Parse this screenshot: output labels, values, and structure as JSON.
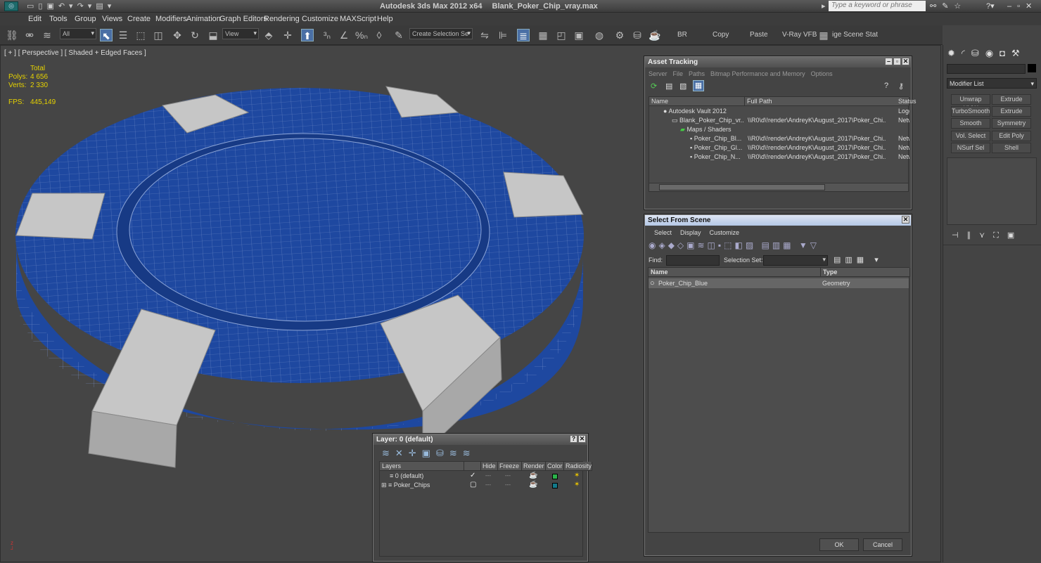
{
  "app": {
    "title": "Autodesk 3ds Max  2012 x64",
    "file": "Blank_Poker_Chip_vray.max",
    "search_placeholder": "Type a keyword or phrase"
  },
  "menu": [
    "Edit",
    "Tools",
    "Group",
    "Views",
    "Create",
    "Modifiers",
    "Animation",
    "Graph Editors",
    "Rendering",
    "Customize",
    "MAXScript",
    "Help"
  ],
  "toolbar": {
    "filter": "All",
    "ref_coord": "View",
    "selection_set": "Create Selection Se",
    "br": "BR",
    "copy": "Copy",
    "paste": "Paste",
    "vray_vfb": "V-Ray VFB",
    "stage": "ige Scene Stat"
  },
  "viewport": {
    "label": "[ + ] [ Perspective ] [ Shaded + Edged Faces ]",
    "stats": {
      "total_label": "Total",
      "polys_label": "Polys:",
      "polys": "4 656",
      "verts_label": "Verts:",
      "verts": "2 330",
      "fps_label": "FPS:",
      "fps": "445,149"
    }
  },
  "asset_tracking": {
    "title": "Asset Tracking",
    "menu": [
      "Server",
      "File",
      "Paths",
      "Bitmap Performance and Memory",
      "Options"
    ],
    "columns": [
      "Name",
      "Full Path",
      "Status"
    ],
    "rows": [
      {
        "name": "Autodesk Vault 2012",
        "path": "",
        "status": "Logged"
      },
      {
        "name": "Blank_Poker_Chip_vr...",
        "path": "\\\\R0\\d\\!render\\AndreyK\\August_2017\\Poker_Chi...",
        "status": "Networ"
      },
      {
        "name": "Maps / Shaders",
        "path": "",
        "status": ""
      },
      {
        "name": "Poker_Chip_Bl...",
        "path": "\\\\R0\\d\\!render\\AndreyK\\August_2017\\Poker_Chi...",
        "status": "Networ"
      },
      {
        "name": "Poker_Chip_Gl...",
        "path": "\\\\R0\\d\\!render\\AndreyK\\August_2017\\Poker_Chi...",
        "status": "Networ"
      },
      {
        "name": "Poker_Chip_N...",
        "path": "\\\\R0\\d\\!render\\AndreyK\\August_2017\\Poker_Chi...",
        "status": "Networ"
      }
    ]
  },
  "select_from_scene": {
    "title": "Select From Scene",
    "menu": [
      "Select",
      "Display",
      "Customize"
    ],
    "find_label": "Find:",
    "selection_set_label": "Selection Set:",
    "columns": [
      "Name",
      "Type"
    ],
    "rows": [
      {
        "name": "Poker_Chip_Blue",
        "type": "Geometry"
      }
    ],
    "ok": "OK",
    "cancel": "Cancel"
  },
  "layer_dialog": {
    "title": "Layer: 0 (default)",
    "columns": [
      "Layers",
      "Hide",
      "Freeze",
      "Render",
      "Color",
      "Radiosity"
    ],
    "rows": [
      {
        "name": "0 (default)",
        "color": "#2bb34a"
      },
      {
        "name": "Poker_Chips",
        "color": "#127a8a"
      }
    ]
  },
  "command_panel": {
    "modifier_list": "Modifier List",
    "buttons": [
      "Unwrap UVW",
      "Extrude",
      "TurboSmooth",
      "Extrude",
      "Smooth",
      "Symmetry",
      "Vol. Select",
      "Edit Poly",
      "NSurf Sel",
      "Shell"
    ]
  },
  "colors": {
    "chip_blue": "#1e48a0",
    "accent": "#4a6fa5"
  }
}
